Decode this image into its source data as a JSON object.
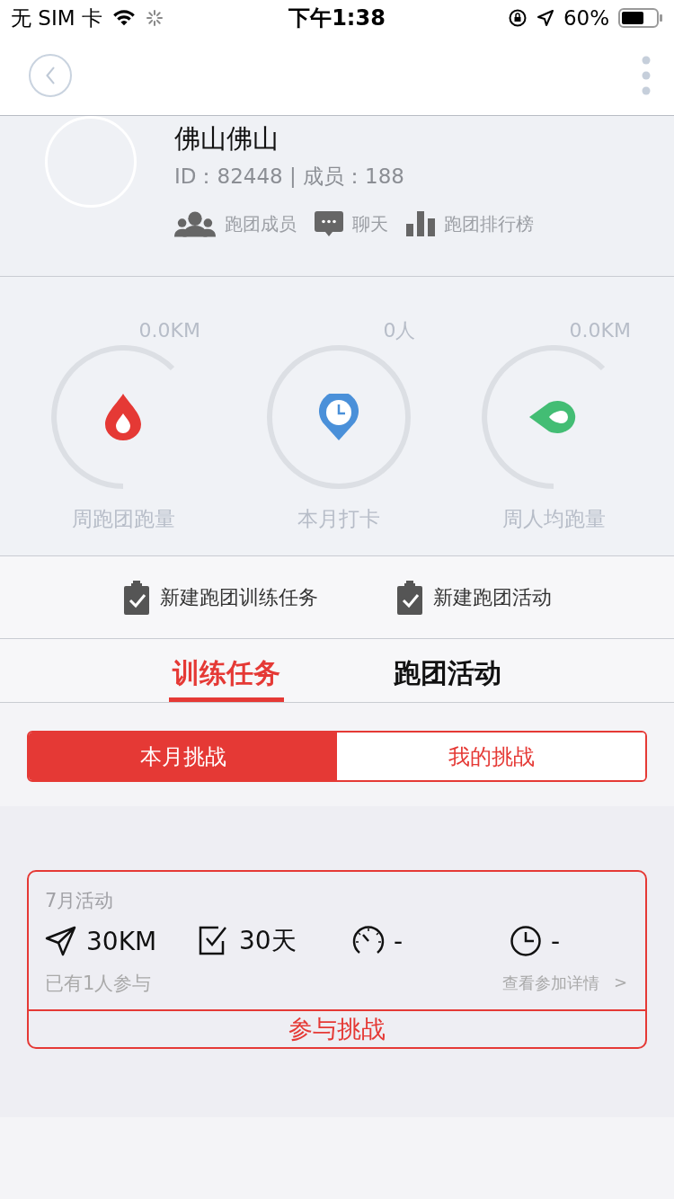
{
  "status_bar": {
    "carrier": "无 SIM 卡",
    "time": "下午1:38",
    "battery": "60%"
  },
  "team": {
    "name": "佛山佛山",
    "info": "ID：82448 | 成员：188",
    "links": [
      {
        "kind": "members",
        "label": "跑团成员"
      },
      {
        "kind": "chat",
        "label": "聊天"
      },
      {
        "kind": "ranking",
        "label": "跑团排行榜"
      }
    ]
  },
  "stats": [
    {
      "kind": "drop",
      "value": "0.0KM",
      "label": "周跑团跑量",
      "color": "#e53935"
    },
    {
      "kind": "pin",
      "value": "0人",
      "label": "本月打卡",
      "color": "#4a90d9"
    },
    {
      "kind": "leaf",
      "value": "0.0KM",
      "label": "周人均跑量",
      "color": "#43bd74"
    }
  ],
  "actions": [
    "新建跑团训练任务",
    "新建跑团活动"
  ],
  "tabs": [
    {
      "label": "训练任务",
      "selected": true
    },
    {
      "label": "跑团活动",
      "selected": false
    }
  ],
  "segments": [
    {
      "label": "本月挑战",
      "selected": true
    },
    {
      "label": "我的挑战",
      "selected": false
    }
  ],
  "challenge": {
    "title": "7月活动",
    "metrics": [
      {
        "kind": "distance",
        "value": "30KM"
      },
      {
        "kind": "days",
        "value": "30天"
      },
      {
        "kind": "pace",
        "value": "-"
      },
      {
        "kind": "time",
        "value": "-"
      }
    ],
    "participants": "已有1人参与",
    "details": "查看参加详情",
    "details_arrow": ">",
    "join": "参与挑战"
  }
}
